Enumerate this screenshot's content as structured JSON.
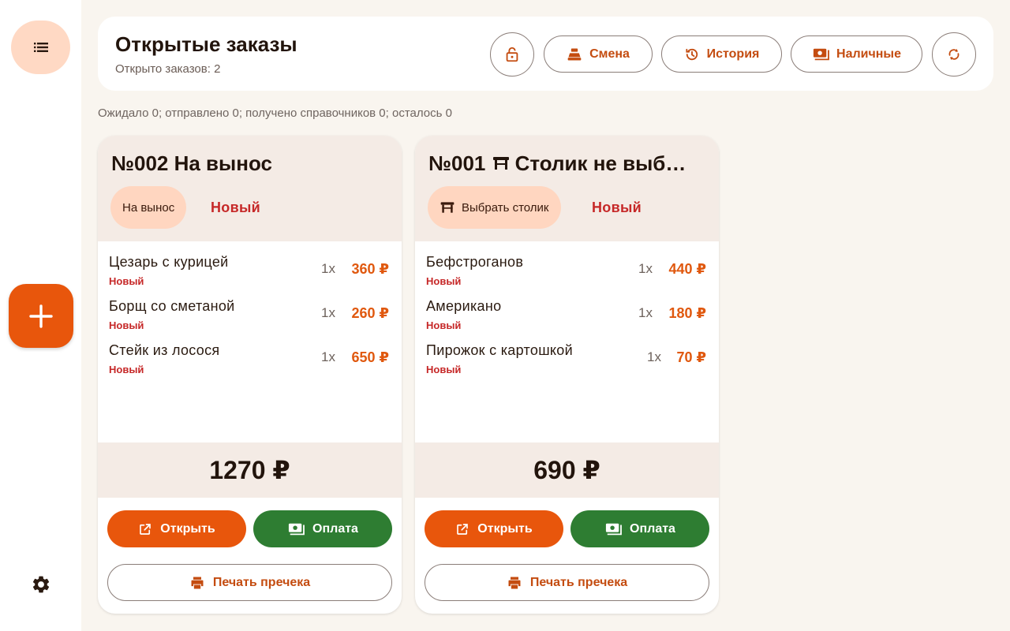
{
  "header": {
    "title": "Открытые заказы",
    "subtitle": "Открыто заказов: 2",
    "buttons": {
      "shift": "Смена",
      "history": "История",
      "cash": "Наличные"
    }
  },
  "status_line": "Ожидало 0; отправлено 0; получено справочников 0; осталось 0",
  "orders": [
    {
      "title": "№002 На вынос",
      "chip": "На вынос",
      "state": "Новый",
      "items": [
        {
          "name": "Цезарь с курицей",
          "status": "Новый",
          "qty": "1x",
          "price": "360 ₽"
        },
        {
          "name": "Борщ со сметаной",
          "status": "Новый",
          "qty": "1x",
          "price": "260 ₽"
        },
        {
          "name": "Стейк из лосося",
          "status": "Новый",
          "qty": "1x",
          "price": "650 ₽"
        }
      ],
      "total": "1270 ₽",
      "open_label": "Открыть",
      "pay_label": "Оплата",
      "print_label": "Печать пречека"
    },
    {
      "title": "№001 Столик не выб…",
      "chip": "Выбрать столик",
      "state": "Новый",
      "items": [
        {
          "name": "Бефстроганов",
          "status": "Новый",
          "qty": "1x",
          "price": "440 ₽"
        },
        {
          "name": "Американо",
          "status": "Новый",
          "qty": "1x",
          "price": "180 ₽"
        },
        {
          "name": "Пирожок с картошкой",
          "status": "Новый",
          "qty": "1x",
          "price": "70 ₽"
        }
      ],
      "total": "690 ₽",
      "open_label": "Открыть",
      "pay_label": "Оплата",
      "print_label": "Печать пречека"
    }
  ],
  "icons": {
    "menu": "list-icon",
    "add": "plus-icon",
    "settings": "gear-icon",
    "lock": "lock-icon",
    "shift": "cash-register-icon",
    "history": "history-icon",
    "cash": "cash-icon",
    "sync": "sync-icon",
    "table": "table-icon",
    "open": "open-external-icon",
    "pay": "payments-icon",
    "print": "print-icon"
  },
  "colors": {
    "accent": "#e8560c",
    "pay": "#2e7d32",
    "status_new": "#c62828",
    "chip": "#ffd6c0",
    "card_header": "#f4ebe5",
    "background": "#f9f5ef"
  }
}
